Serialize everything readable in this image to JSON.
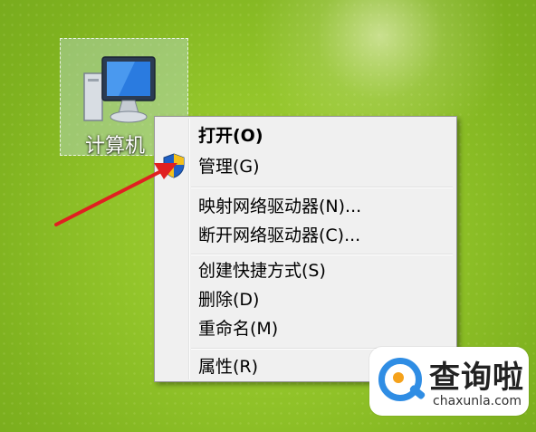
{
  "desktop": {
    "icon_label": "计算机",
    "icon_name": "computer-icon"
  },
  "context_menu": {
    "items": [
      {
        "label": "打开(O)",
        "bold": true
      },
      {
        "label": "管理(G)",
        "icon": "uac-shield-icon"
      },
      {
        "label": "映射网络驱动器(N)..."
      },
      {
        "label": "断开网络驱动器(C)..."
      },
      {
        "label": "创建快捷方式(S)"
      },
      {
        "label": "删除(D)"
      },
      {
        "label": "重命名(M)"
      },
      {
        "label": "属性(R)"
      }
    ]
  },
  "annotation": {
    "arrow_color": "#e02020"
  },
  "watermark": {
    "title": "查询啦",
    "url": "chaxunla.com",
    "accent": "#2f8de4",
    "dot_color": "#f5a21b"
  }
}
